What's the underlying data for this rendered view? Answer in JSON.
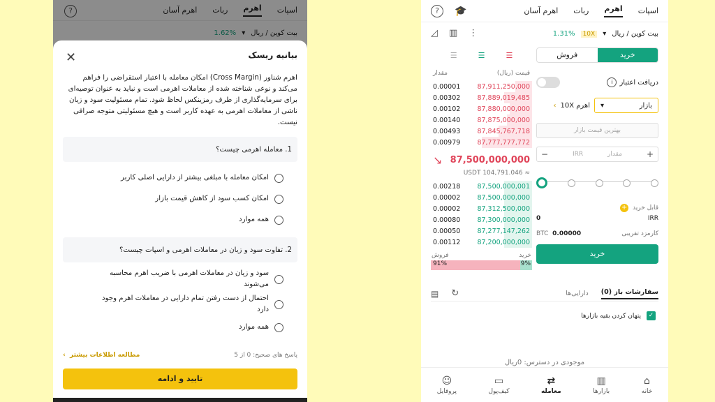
{
  "left": {
    "tabs": [
      "اسپات",
      "اهرم",
      "ربات",
      "اهرم آسان"
    ],
    "pair": "بیت کوین / ریال",
    "change": "1.62%",
    "modal": {
      "title": "بیانیه ریسک",
      "intro": "اهرم شناور (Cross Margin) امکان معامله با اعتبار استقراضی را فراهم می‌کند و نوعی شناخته شده از معاملات اهرمی است و نباید به عنوان توصیه‌ای برای سرمایه‌گذاری از طرف رمزینکس لحاظ شود. تمام مسئولیت سود و زیان ناشی از معاملات اهرمی به عهده کاربر است و هیچ مسئولیتی متوجه صرافی نیست.",
      "q1": "1. معامله اهرمی چیست؟",
      "q1_options": [
        "امکان معامله با مبلغی بیشتر از دارایی اصلی کاربر",
        "امکان کسب سود از کاهش قیمت بازار",
        "همه موارد"
      ],
      "q2": "2. تفاوت سود و زیان در معاملات اهرمی و اسپات چیست؟",
      "q2_options": [
        "سود و زیان در معاملات اهرمی با ضریب اهرم محاسبه می‌شوند",
        "احتمال از دست رفتن تمام دارایی در معاملات اهرم وجود دارد",
        "همه موارد"
      ],
      "score": "پاسخ های صحیح: 0 از 5",
      "more": "مطالعه اطلاعات بیشتر",
      "confirm": "تایید و ادامه"
    }
  },
  "right": {
    "tabs": [
      "اسپات",
      "اهرم",
      "ربات",
      "اهرم آسان"
    ],
    "pair": "بیت کوین / ریال",
    "leverage_badge": "10X",
    "change": "1.31%",
    "buy": "خرید",
    "sell": "فروش",
    "credit_label": "دریافت اعتبار",
    "order_type": "بازار",
    "leverage": "اهرم 10X",
    "best_price_placeholder": "بهترین قیمت بازار",
    "amount_placeholder": "مقدار",
    "amount_unit": "IRR",
    "available_label": "قابل خرید",
    "available_value": "0",
    "available_unit": "IRR",
    "fee_label": "کارمزد تقریبی",
    "fee_value": "0.00000",
    "fee_unit": "BTC",
    "buy_button": "خرید",
    "ob_header_price": "قیمت (ریال)",
    "ob_header_amount": "مقدار",
    "asks": [
      {
        "price": "87,911,250,000",
        "amount": "0.00001",
        "depth": 0.3
      },
      {
        "price": "87,889,019,485",
        "amount": "0.00302",
        "depth": 0.5
      },
      {
        "price": "87,880,000,000",
        "amount": "0.00102",
        "depth": 0.4
      },
      {
        "price": "87,875,000,000",
        "amount": "0.00140",
        "depth": 0.45
      },
      {
        "price": "87,845,767,718",
        "amount": "0.00493",
        "depth": 0.6
      },
      {
        "price": "87,777,777,772",
        "amount": "0.00979",
        "depth": 0.9
      }
    ],
    "last_price": "87,500,000,000",
    "last_price_usdt": "≈ 104,791.046 USDT",
    "bids": [
      {
        "price": "87,500,000,001",
        "amount": "0.00218"
      },
      {
        "price": "87,500,000,000",
        "amount": "0.00002"
      },
      {
        "price": "87,312,500,000",
        "amount": "0.00002"
      },
      {
        "price": "87,300,000,000",
        "amount": "0.00080"
      },
      {
        "price": "87,277,147,262",
        "amount": "0.00050"
      },
      {
        "price": "87,200,000,000",
        "amount": "0.00112"
      }
    ],
    "ratio_buy_label": "خرید",
    "ratio_sell_label": "فروش",
    "ratio_buy": "9%",
    "ratio_sell": "91%",
    "open_orders": "سفارشات باز (0)",
    "assets": "دارایی‌ها",
    "hide_other": "پنهان کردن بقیه بازارها",
    "balance": "موجودی در دسترس: 0ریال",
    "nav": [
      "خانه",
      "بازارها",
      "معامله",
      "کیف‌پول",
      "پروفایل"
    ]
  }
}
